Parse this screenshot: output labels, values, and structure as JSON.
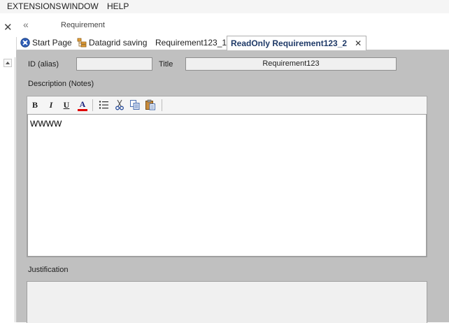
{
  "menu": {
    "items": [
      "EXTENSIONS",
      "WINDOW",
      "HELP"
    ]
  },
  "window": {
    "title": "Requirement",
    "collapse_glyph": "«",
    "close_glyph": "✕"
  },
  "tabs": [
    {
      "label": "Start Page",
      "icon": "start-page-icon"
    },
    {
      "label": "Datagrid saving",
      "icon": "datagrid-icon"
    },
    {
      "label": "Requirement123_1",
      "icon": ""
    },
    {
      "label": "ReadOnly Requirement123_2",
      "icon": "",
      "active": true,
      "close": "✕"
    }
  ],
  "form": {
    "id_label": "ID (alias)",
    "id_value": "",
    "title_label": "Title",
    "title_value": "Requirement123",
    "description_label": "Description (Notes)",
    "description_text": "WWWW",
    "justification_label": "Justification"
  },
  "toolbar": {
    "bold": "B",
    "italic": "I",
    "underline": "U",
    "font_color": "A"
  },
  "colors": {
    "content_bg": "#c0c0c0",
    "active_tab_text": "#1f3a68",
    "font_color_bar": "#e00000"
  }
}
